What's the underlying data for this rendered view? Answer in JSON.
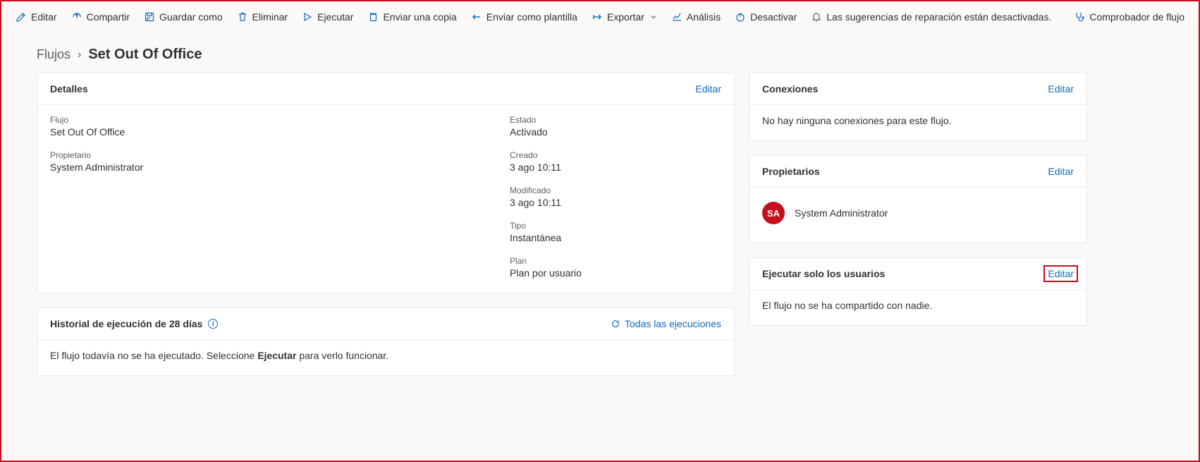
{
  "toolbar": {
    "edit": "Editar",
    "share": "Compartir",
    "saveAs": "Guardar como",
    "delete": "Eliminar",
    "run": "Ejecutar",
    "sendCopy": "Enviar una copia",
    "sendTemplate": "Enviar como plantilla",
    "export": "Exportar",
    "analytics": "Análisis",
    "disable": "Desactivar",
    "repairSuggestions": "Las sugerencias de reparación están desactivadas.",
    "flowChecker": "Comprobador de flujo"
  },
  "breadcrumb": {
    "prev": "Flujos",
    "current": "Set Out Of Office"
  },
  "details": {
    "title": "Detalles",
    "editLabel": "Editar",
    "flowLabel": "Flujo",
    "flowValue": "Set Out Of Office",
    "ownerLabel": "Propietario",
    "ownerValue": "System Administrator",
    "statusLabel": "Estado",
    "statusValue": "Activado",
    "createdLabel": "Creado",
    "createdValue": "3 ago 10:11",
    "modifiedLabel": "Modificado",
    "modifiedValue": "3 ago 10:11",
    "typeLabel": "Tipo",
    "typeValue": "Instantánea",
    "planLabel": "Plan",
    "planValue": "Plan por usuario"
  },
  "runHistory": {
    "title": "Historial de ejecución de 28 días",
    "allRuns": "Todas las ejecuciones",
    "emptyPrefix": "El flujo todavía no se ha ejecutado. Seleccione ",
    "emptyBold": "Ejecutar",
    "emptySuffix": " para verlo funcionar."
  },
  "connections": {
    "title": "Conexiones",
    "editLabel": "Editar",
    "empty": "No hay ninguna conexiones para este flujo."
  },
  "owners": {
    "title": "Propietarios",
    "editLabel": "Editar",
    "initials": "SA",
    "name": "System Administrator"
  },
  "runOnly": {
    "title": "Ejecutar solo los usuarios",
    "editLabel": "Editar",
    "empty": "El flujo no se ha compartido con nadie."
  }
}
